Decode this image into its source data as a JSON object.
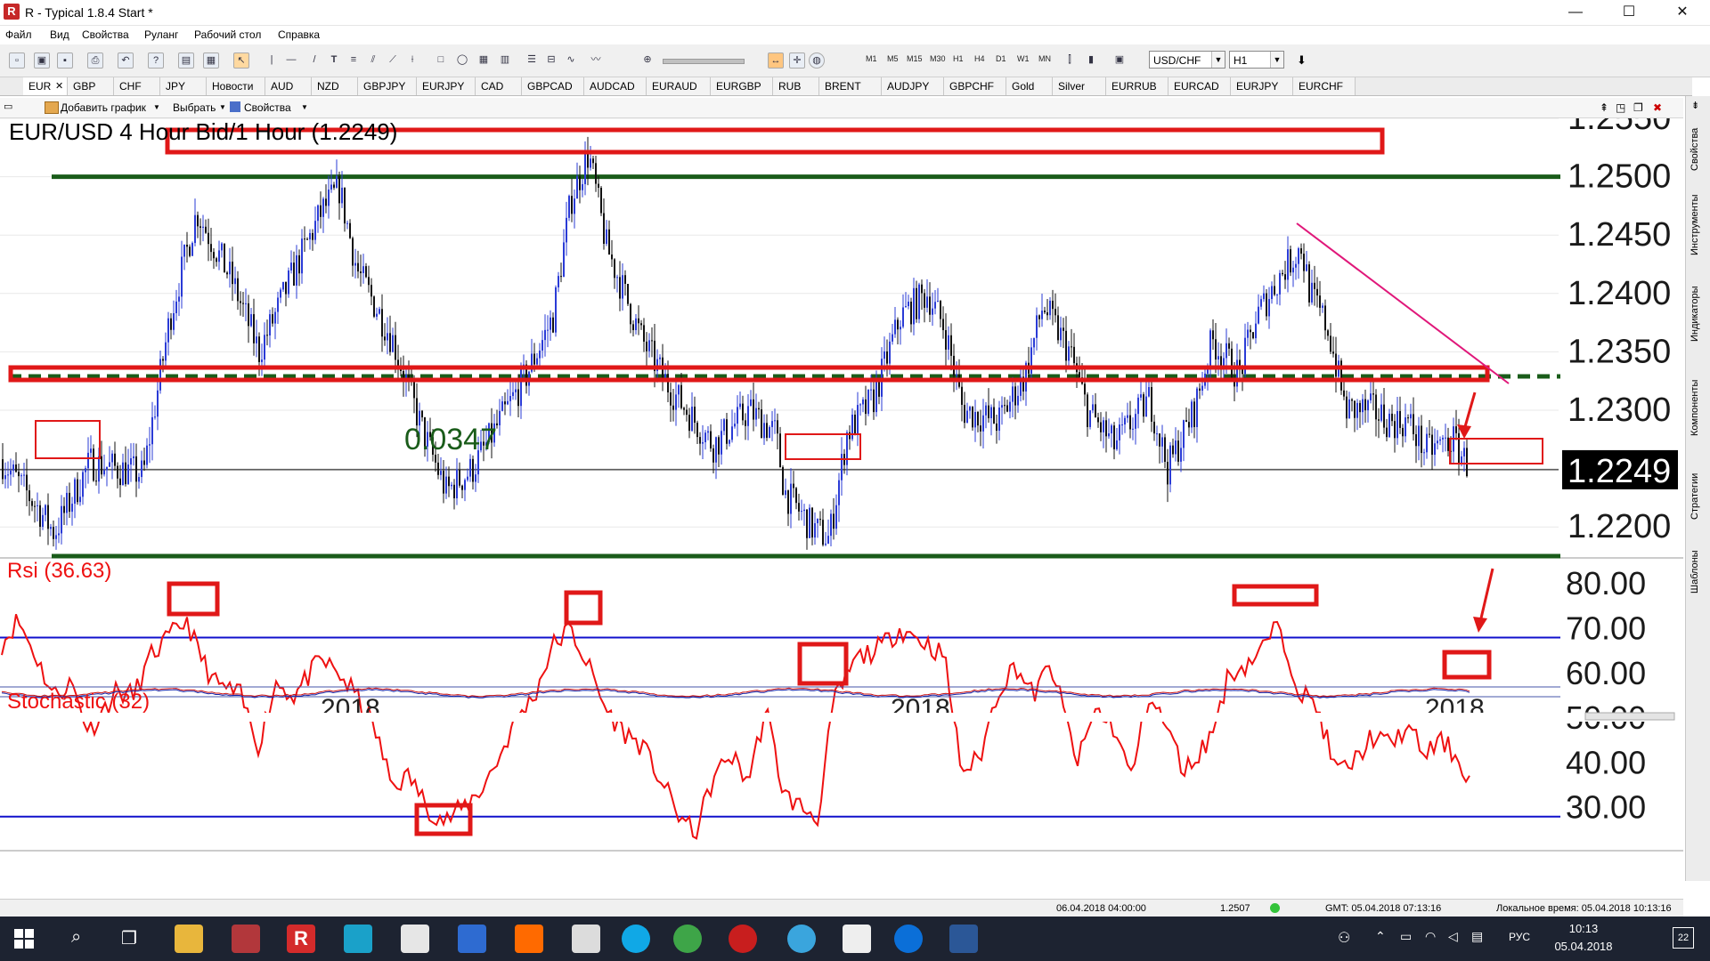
{
  "window": {
    "title": "R - Typical 1.8.4 Start *",
    "minimize": "—",
    "maximize": "☐",
    "close": "✕"
  },
  "menu": [
    "Файл",
    "Вид",
    "Свойства",
    "Руланг",
    "Рабочий стол",
    "Справка"
  ],
  "toolbar": {
    "timeframes": [
      "M1",
      "M5",
      "M15",
      "M30",
      "H1",
      "H4",
      "D1",
      "W1",
      "MN"
    ],
    "symbol": "USD/CHF",
    "timeframe": "H1"
  },
  "tabs": [
    "EUR",
    "GBP",
    "CHF",
    "JPY",
    "Новости",
    "AUD",
    "NZD",
    "GBPJPY",
    "EURJPY",
    "CAD",
    "GBPCAD",
    "AUDCAD",
    "EURAUD",
    "EURGBP",
    "RUB",
    "BRENT",
    "AUDJPY",
    "GBPCHF",
    "Gold",
    "Silver",
    "EURRUB",
    "EURCAD",
    "EURJPY",
    "EURCHF"
  ],
  "chart_toolbar": {
    "add_chart": "Добавить график",
    "select": "Выбрать",
    "properties": "Свойства"
  },
  "right_tabs": [
    "Свойства",
    "Инструменты",
    "Индикаторы",
    "Компоненты",
    "Стратегии",
    "Шаблоны"
  ],
  "chart_data": [
    {
      "type": "candlestick",
      "title": "EUR/USD 4 Hour Bid/1 Hour (1.2249)",
      "current_price": "1.2249",
      "y_ticks": [
        "1.2550",
        "1.2500",
        "1.2450",
        "1.2400",
        "1.2350",
        "1.2300",
        "1.2250",
        "1.2200"
      ],
      "ylim": [
        1.2175,
        1.255
      ],
      "annotation": "0.0347",
      "levels": [
        {
          "value": 1.25,
          "style": "solid",
          "color": "#1a5c1a"
        },
        {
          "value": 1.2329,
          "style": "dashed",
          "color": "#1a5c1a"
        },
        {
          "value": 1.2175,
          "style": "solid",
          "color": "#1a5c1a"
        }
      ],
      "colors": {
        "up": "#2a3bd6",
        "down": "#111111",
        "rect": "#e01818",
        "trend": "#e0187a"
      }
    },
    {
      "type": "line",
      "title": "Rsi (36.63)",
      "y_ticks": [
        "80.00",
        "70.00",
        "60.00",
        "50.00",
        "40.00",
        "30.00"
      ],
      "ylim": [
        22,
        84
      ],
      "levels": [
        68,
        28
      ],
      "color": "#ee1111",
      "level_color": "#1010cc"
    },
    {
      "type": "line",
      "title": "Stochastic (32)",
      "color": "#cc1111"
    }
  ],
  "time_axis": {
    "labels": [
      "2018",
      "2018",
      "2018"
    ]
  },
  "status": {
    "time": "06.04.2018 04:00:00",
    "price": "1.2507",
    "gmt": "GMT: 05.04.2018 07:13:16",
    "local": "Локальное время: 05.04.2018 10:13:16"
  },
  "taskbar": {
    "time": "10:13",
    "date": "05.04.2018",
    "lang": "РУС",
    "notifications": "22"
  }
}
